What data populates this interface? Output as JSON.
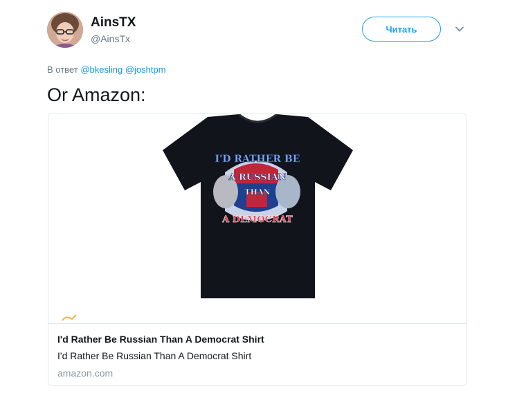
{
  "author": {
    "name": "AinsTX",
    "handle": "@AinsTx"
  },
  "follow_button": {
    "label": "Читать"
  },
  "menu_icon": "chevron-down-icon",
  "reply": {
    "prefix": "В ответ",
    "mentions": [
      "@bkesling",
      "@joshtpm"
    ]
  },
  "tweet": {
    "text": "Or Amazon:"
  },
  "card": {
    "image_text": {
      "line1": "I'D RATHER BE",
      "line2": "A RUSSIAN",
      "line3": "THAN",
      "line4": "A DEMOCRAT"
    },
    "title": "I'd Rather Be Russian Than A Democrat Shirt",
    "description": "I'd Rather Be Russian Than A Democrat Shirt",
    "domain": "amazon.com"
  },
  "colors": {
    "accent": "#1da1f2",
    "mention": "#1b95e0",
    "secondary_text": "#657786",
    "border": "#e1e8ed"
  }
}
